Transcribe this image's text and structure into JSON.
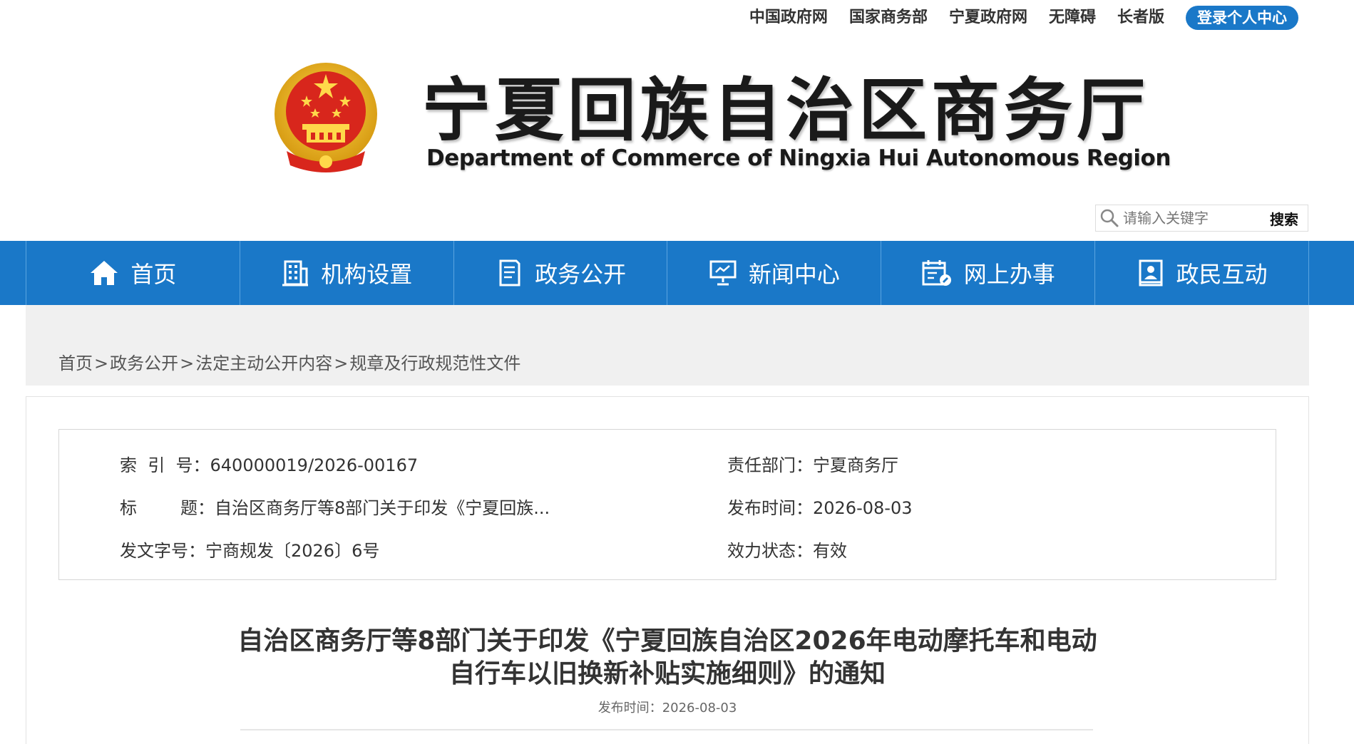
{
  "top_links": [
    "中国政府网",
    "国家商务部",
    "宁夏政府网",
    "无障碍",
    "长者版"
  ],
  "login_label": "登录个人中心",
  "site": {
    "title": "宁夏回族自治区商务厅",
    "subtitle": "Department of Commerce of Ningxia Hui Autonomous Region"
  },
  "search": {
    "placeholder": "请输入关键字",
    "button": "搜索"
  },
  "nav": [
    {
      "label": "首页",
      "icon": "home-icon"
    },
    {
      "label": "机构设置",
      "icon": "building-icon"
    },
    {
      "label": "政务公开",
      "icon": "document-icon"
    },
    {
      "label": "新闻中心",
      "icon": "presentation-icon"
    },
    {
      "label": "网上办事",
      "icon": "calendar-edit-icon"
    },
    {
      "label": "政民互动",
      "icon": "user-card-icon"
    }
  ],
  "breadcrumb": [
    "首页",
    "政务公开",
    "法定主动公开内容",
    "规章及行政规范性文件"
  ],
  "breadcrumb_sep": ">",
  "meta": {
    "index_label": "索  引  号：",
    "index_value": "640000019/2026-00167",
    "dept_label": "责任部门：",
    "dept_value": "宁夏商务厅",
    "title_label": "标        题：",
    "title_value": "自治区商务厅等8部门关于印发《宁夏回族...",
    "date_label": "发布时间：",
    "date_value": "2026-08-03",
    "docno_label": "发文字号：",
    "docno_value": "宁商规发〔2026〕6号",
    "status_label": "效力状态：",
    "status_value": "有效"
  },
  "document": {
    "title_line1": "自治区商务厅等8部门关于印发《宁夏回族自治区2026年电动摩托车和电动",
    "title_line2": "自行车以旧换新补贴实施细则》的通知",
    "date_label": "发布时间：",
    "date_value": "2026-08-03"
  },
  "colors": {
    "brand_blue": "#1a78c8",
    "crumb_bg": "#f0f0f0"
  }
}
